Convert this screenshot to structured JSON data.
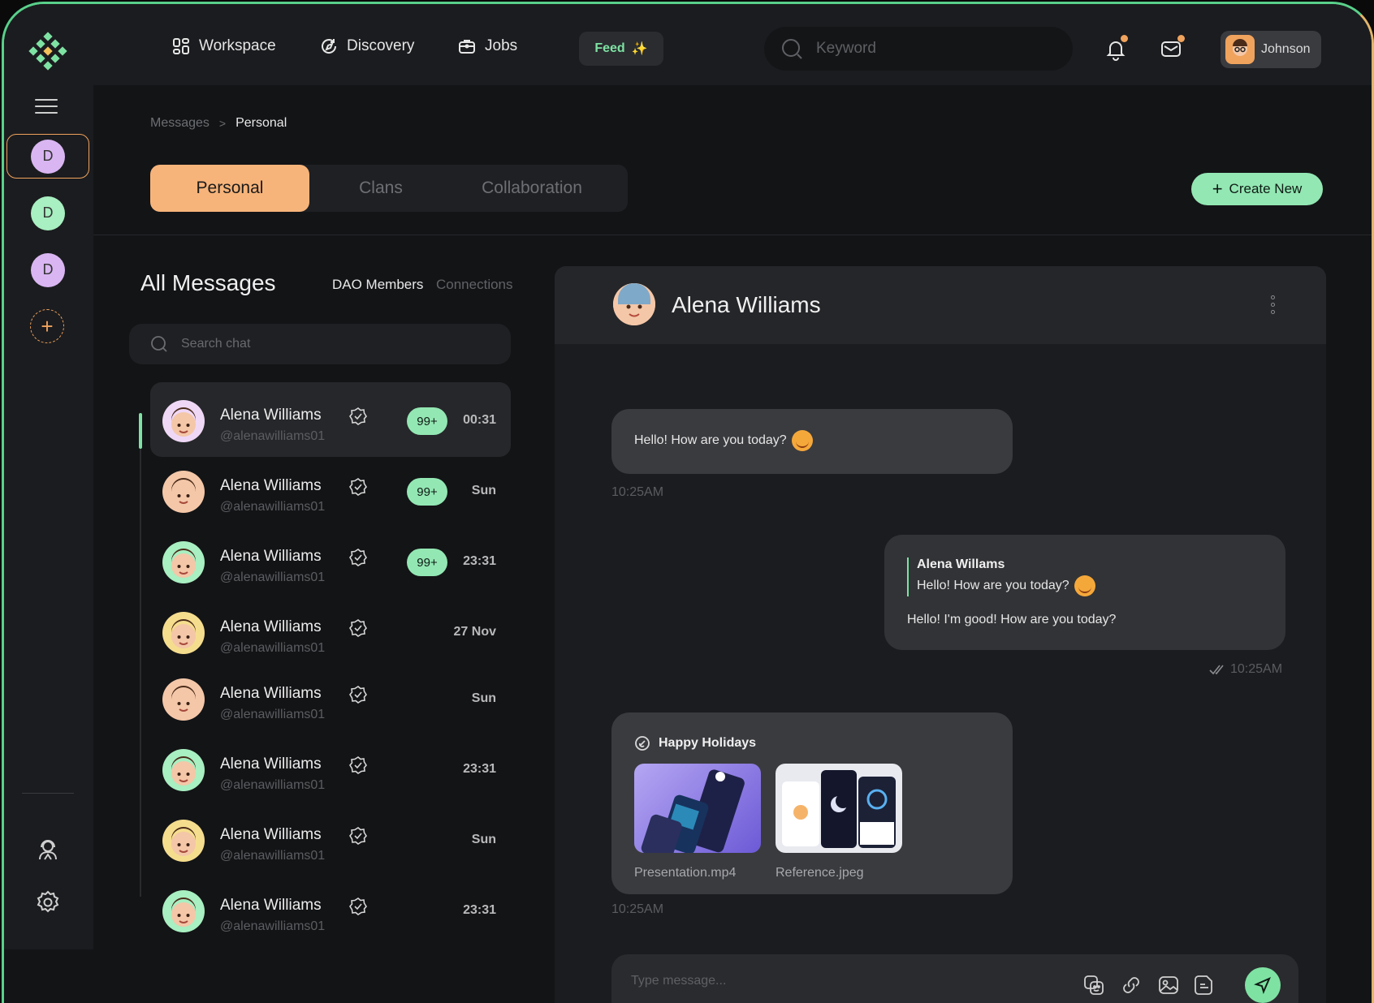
{
  "topbar": {
    "nav": [
      {
        "label": "Workspace",
        "icon": "workspace-grid-icon"
      },
      {
        "label": "Discovery",
        "icon": "discovery-icon"
      },
      {
        "label": "Jobs",
        "icon": "jobs-briefcase-icon"
      }
    ],
    "feed_label": "Feed",
    "feed_icon": "sparkles-icon",
    "search_placeholder": "Keyword",
    "user_name": "Johnson"
  },
  "rail": {
    "workspaces": [
      "D",
      "D",
      "D"
    ],
    "workspace_colors": [
      "#d9b6f2",
      "#a8efc1",
      "#d9b6f2"
    ]
  },
  "breadcrumb": {
    "parent": "Messages",
    "current": "Personal"
  },
  "tabs": [
    "Personal",
    "Clans",
    "Collaboration"
  ],
  "create_label": "Create New",
  "list": {
    "title": "All Messages",
    "filters": [
      "DAO Members",
      "Connections"
    ],
    "search_placeholder": "Search chat",
    "conversations": [
      {
        "name": "Alena Williams",
        "handle": "@alenawilliams01",
        "badge": "99+",
        "time": "00:31",
        "avatar_color": "#efd8f6"
      },
      {
        "name": "Alena Williams",
        "handle": "@alenawilliams01",
        "badge": "99+",
        "time": "Sun",
        "avatar_color": "#f4c7a8"
      },
      {
        "name": "Alena Williams",
        "handle": "@alenawilliams01",
        "badge": "99+",
        "time": "23:31",
        "avatar_color": "#a8efc1"
      },
      {
        "name": "Alena Williams",
        "handle": "@alenawilliams01",
        "badge": "",
        "time": "27 Nov",
        "avatar_color": "#f5dd8e"
      },
      {
        "name": "Alena Williams",
        "handle": "@alenawilliams01",
        "badge": "",
        "time": "Sun",
        "avatar_color": "#f4c7a8"
      },
      {
        "name": "Alena Williams",
        "handle": "@alenawilliams01",
        "badge": "",
        "time": "23:31",
        "avatar_color": "#a8efc1"
      },
      {
        "name": "Alena Williams",
        "handle": "@alenawilliams01",
        "badge": "",
        "time": "Sun",
        "avatar_color": "#f5dd8e"
      },
      {
        "name": "Alena Williams",
        "handle": "@alenawilliams01",
        "badge": "",
        "time": "23:31",
        "avatar_color": "#a8efc1"
      }
    ]
  },
  "chat": {
    "contact_name": "Alena Williams",
    "messages": {
      "m1_text": "Hello! How are you today?",
      "m1_time": "10:25AM",
      "m2_quote_name": "Alena Willams",
      "m2_quote_text": "Hello! How are you today?",
      "m2_text": "Hello! I'm good! How are you today?",
      "m2_time": "10:25AM",
      "m3_title": "Happy Holidays",
      "m3_files": [
        "Presentation.mp4",
        "Reference.jpeg"
      ],
      "m3_time": "10:25AM"
    },
    "composer_placeholder": "Type message..."
  },
  "colors": {
    "accent_green": "#7ee2a3",
    "accent_orange": "#f7b47a",
    "background": "#131416"
  }
}
